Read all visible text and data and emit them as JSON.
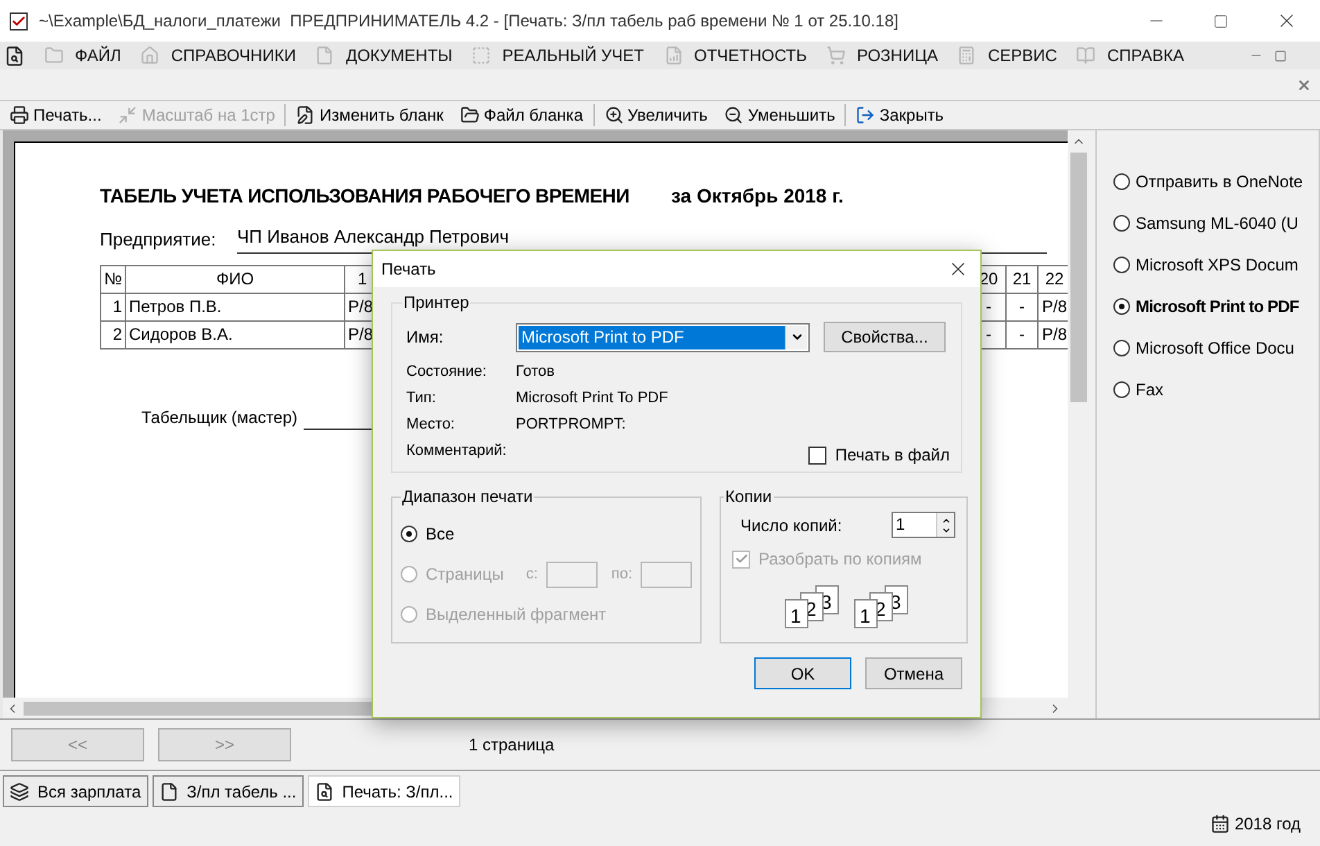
{
  "window": {
    "title": "~\\Example\\БД_налоги_платежи  ПРЕДПРИНИМАТЕЛЬ 4.2 - [Печать: З/пл табель раб времени № 1 от 25.10.18]"
  },
  "menu": [
    {
      "label": "ФАЙЛ"
    },
    {
      "label": "СПРАВОЧНИКИ"
    },
    {
      "label": "ДОКУМЕНТЫ"
    },
    {
      "label": "РЕАЛЬНЫЙ УЧЕТ"
    },
    {
      "label": "ОТЧЕТНОСТЬ"
    },
    {
      "label": "РОЗНИЦА"
    },
    {
      "label": "СЕРВИС"
    },
    {
      "label": "СПРАВКА"
    }
  ],
  "toolbar": [
    {
      "label": "Печать...",
      "disabled": false
    },
    {
      "label": "Масштаб на 1стр",
      "disabled": true
    },
    {
      "label": "Изменить бланк",
      "disabled": false
    },
    {
      "label": "Файл бланка",
      "disabled": false
    },
    {
      "label": "Увеличить",
      "disabled": false
    },
    {
      "label": "Уменьшить",
      "disabled": false
    },
    {
      "label": "Закрыть",
      "disabled": false
    }
  ],
  "document": {
    "title": "ТАБЕЛЬ УЧЕТА ИСПОЛЬЗОВАНИЯ РАБОЧЕГО ВРЕМЕНИ",
    "period": "за Октябрь 2018 г.",
    "enterprise_label": "Предприятие:",
    "enterprise": "ЧП Иванов Александр Петрович",
    "table": {
      "columns": [
        "№",
        "ФИО",
        "1",
        "20",
        "21",
        "22"
      ],
      "rows": [
        [
          "1",
          "Петров П.В.",
          "Р/8",
          "-",
          "-",
          "Р/8"
        ],
        [
          "2",
          "Сидоров В.А.",
          "Р/8",
          "-",
          "-",
          "Р/8"
        ]
      ]
    },
    "signature_label": "Табельщик (мастер)"
  },
  "dialog": {
    "title": "Печать",
    "printer": {
      "legend": "Принтер",
      "name_label": "Имя:",
      "name": "Microsoft Print to PDF",
      "properties": "Свойства...",
      "info": [
        {
          "label": "Состояние:",
          "value": "Готов"
        },
        {
          "label": "Тип:",
          "value": "Microsoft Print To PDF"
        },
        {
          "label": "Место:",
          "value": "PORTPROMPT:"
        },
        {
          "label": "Комментарий:"
        }
      ],
      "print_to_file": {
        "label": "Печать в файл",
        "checked": false
      }
    },
    "range": {
      "legend": "Диапазон печати",
      "options": [
        {
          "label": "Все",
          "selected": true,
          "disabled": false
        },
        {
          "label": "Страницы",
          "selected": false,
          "disabled": true
        },
        {
          "label": "Выделенный фрагмент",
          "selected": false,
          "disabled": true
        }
      ],
      "from_label": "с:",
      "to_label": "по:"
    },
    "copies": {
      "legend": "Копии",
      "count_label": "Число копий:",
      "count": "1",
      "collate": {
        "label": "Разобрать по копиям",
        "checked": true,
        "disabled": true
      },
      "stacks": [
        [
          "1",
          "2",
          "3"
        ],
        [
          "1",
          "2",
          "3"
        ]
      ]
    },
    "buttons": [
      "OK",
      "Отмена"
    ]
  },
  "printers": [
    {
      "label": "Отправить в OneNote",
      "selected": false
    },
    {
      "label": "Samsung  ML-6040 (U",
      "selected": false
    },
    {
      "label": "Microsoft XPS Docum",
      "selected": false
    },
    {
      "label": "Microsoft Print to PDF",
      "selected": true
    },
    {
      "label": "Microsoft Office Docu",
      "selected": false
    },
    {
      "label": "Fax",
      "selected": false
    }
  ],
  "pager": {
    "prev": "<<",
    "next": ">>",
    "page": "1 страница"
  },
  "tasks": [
    {
      "label": "Вся зарплата",
      "selected": false
    },
    {
      "label": "З/пл табель ...",
      "selected": false
    },
    {
      "label": "Печать: З/пл...",
      "selected": true
    }
  ],
  "status": "2018 год"
}
